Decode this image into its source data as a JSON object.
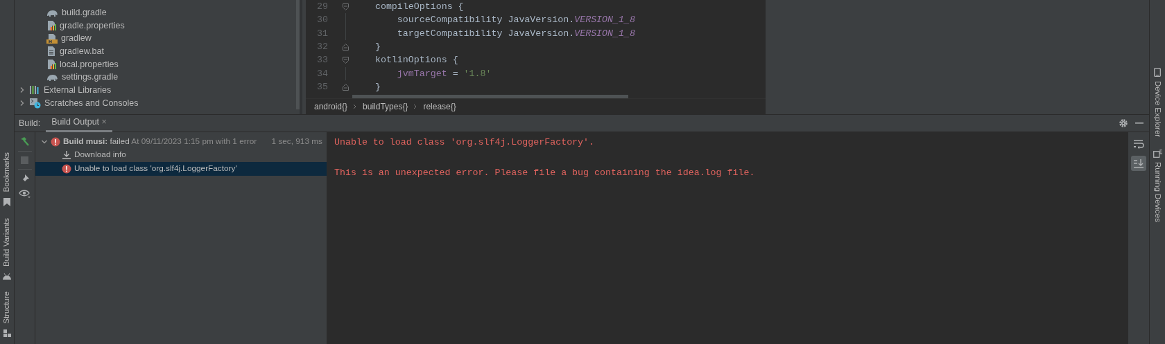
{
  "left_strip": [
    {
      "label": "Bookmarks",
      "kind": "bookmark"
    },
    {
      "label": "Build Variants",
      "kind": "android"
    },
    {
      "label": "Structure",
      "kind": "structure"
    }
  ],
  "right_strip": [
    {
      "label": "Device Explorer",
      "kind": "device"
    },
    {
      "label": "Running Devices",
      "kind": "running"
    }
  ],
  "project_tree": [
    {
      "children": [
        {
          "label": "build.gradle",
          "kind": "gradle"
        },
        {
          "label": "gradle.properties",
          "kind": "properties"
        },
        {
          "label": "gradlew",
          "kind": "shell"
        },
        {
          "label": "gradlew.bat",
          "kind": "text"
        },
        {
          "label": "local.properties",
          "kind": "properties"
        },
        {
          "label": "settings.gradle",
          "kind": "gradle"
        }
      ]
    },
    {
      "label": "External Libraries",
      "kind": "libraries",
      "expanded": false
    },
    {
      "label": "Scratches and Consoles",
      "kind": "scratches",
      "expanded": false
    }
  ],
  "editor": {
    "lines": [
      {
        "number": "29",
        "kind": "fold-start",
        "tokens": [
          {
            "kind": "plain",
            "t": "    compileOptions {"
          }
        ]
      },
      {
        "number": "30",
        "kind": "plain",
        "tokens": [
          {
            "kind": "plain",
            "t": "        sourceCompatibility JavaVersion."
          },
          {
            "kind": "constant",
            "t": "VERSION_1_8"
          }
        ]
      },
      {
        "number": "31",
        "kind": "plain",
        "tokens": [
          {
            "kind": "plain",
            "t": "        targetCompatibility JavaVersion."
          },
          {
            "kind": "constant",
            "t": "VERSION_1_8"
          }
        ]
      },
      {
        "number": "32",
        "kind": "fold-end",
        "tokens": [
          {
            "kind": "plain",
            "t": "    }"
          }
        ]
      },
      {
        "number": "33",
        "kind": "fold-start",
        "tokens": [
          {
            "kind": "plain",
            "t": "    kotlinOptions {"
          }
        ]
      },
      {
        "number": "34",
        "kind": "plain",
        "tokens": [
          {
            "kind": "field",
            "t": "        jvmTarget"
          },
          {
            "kind": "plain",
            "t": " = "
          },
          {
            "kind": "string",
            "t": "'1.8'"
          }
        ]
      },
      {
        "number": "35",
        "kind": "fold-end",
        "tokens": [
          {
            "kind": "plain",
            "t": "    }"
          }
        ]
      }
    ],
    "breadcrumbs": [
      "android{}",
      "buildTypes{}",
      "release{}"
    ]
  },
  "build_panel": {
    "title": "Build:",
    "tabs": [
      {
        "label": "Build Output",
        "selected": true,
        "close": "×"
      }
    ],
    "tree": [
      {
        "title": "Build musi:",
        "status": "failed",
        "detail": "At 09/11/2023 1:15 pm with 1 error",
        "time": "1 sec, 913 ms",
        "kind": "error",
        "expanded": true,
        "selected": false,
        "children": [
          {
            "label": "Download info",
            "kind": "download",
            "selected": false
          },
          {
            "label": "Unable to load class 'org.slf4j.LoggerFactory'",
            "kind": "error",
            "selected": true
          }
        ]
      }
    ],
    "console": [
      "Unable to load class 'org.slf4j.LoggerFactory'.",
      "This is an unexpected error. Please file a bug containing the idea.log file."
    ],
    "right_toolbar": [
      {
        "kind": "wrap",
        "selected": false
      },
      {
        "kind": "scroll-end",
        "selected": true
      }
    ]
  }
}
